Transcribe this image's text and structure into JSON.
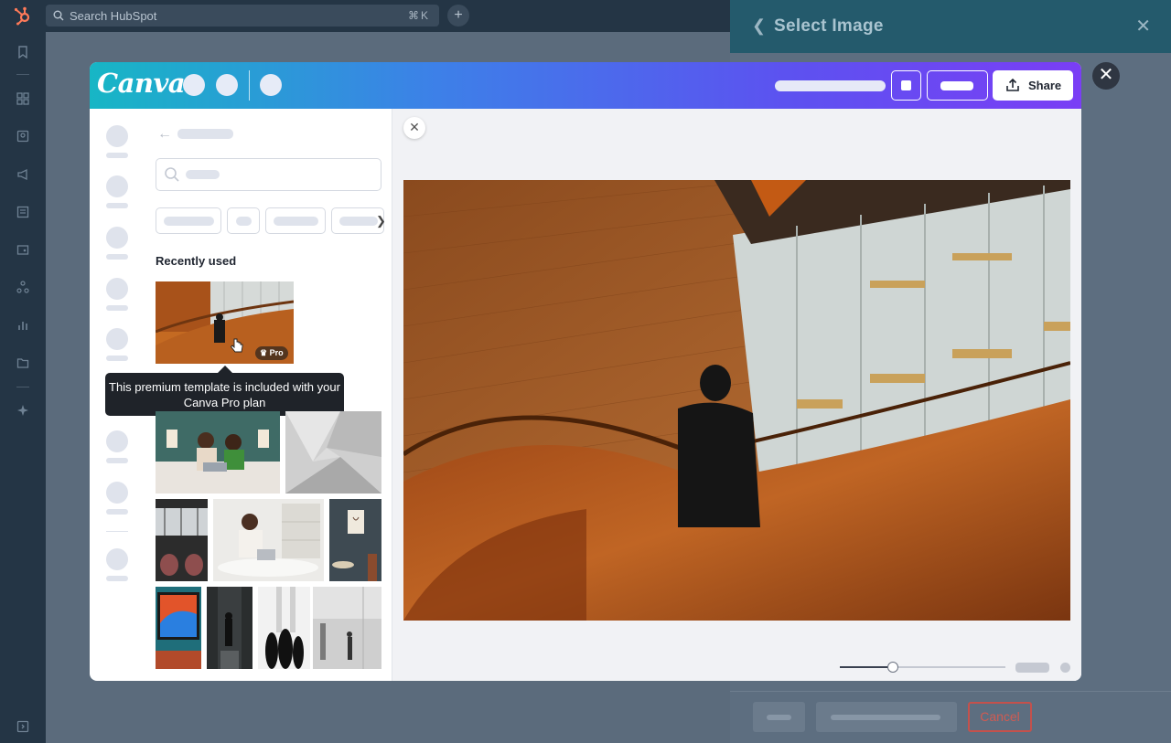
{
  "hubspot": {
    "search_placeholder": "Search HubSpot",
    "search_shortcut": "⌘K",
    "nav_icons": [
      "bookmark-icon",
      "grid-icon",
      "contacts-icon",
      "megaphone-icon",
      "content-icon",
      "commerce-icon",
      "automation-icon",
      "reports-icon",
      "folder-icon",
      "sparkle-icon",
      "expand-icon"
    ]
  },
  "panel": {
    "title": "Select Image",
    "cancel_label": "Cancel"
  },
  "canva": {
    "logo": "Canva",
    "share_label": "Share",
    "recently_used_label": "Recently used",
    "pro_badge": "Pro",
    "tooltip": "This premium template is included with your Canva Pro plan",
    "zoom_level": 0.32
  },
  "colors": {
    "hubspot_nav": "#243545",
    "panel_header": "#245a6c",
    "cancel_red": "#d05b52",
    "canva_gradient_start": "#17b6c5",
    "canva_gradient_end": "#7a3ef5"
  }
}
